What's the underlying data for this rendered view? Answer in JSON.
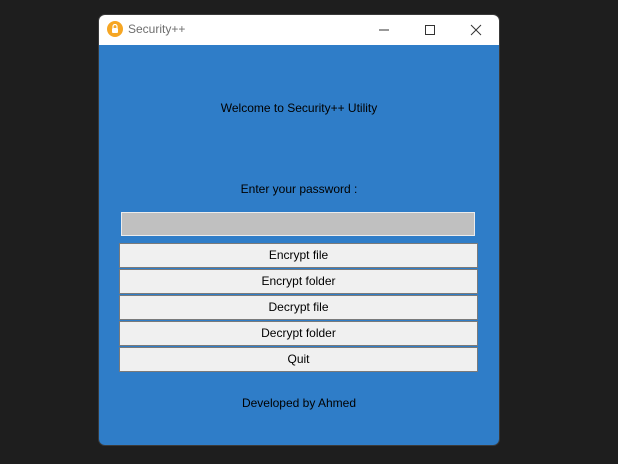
{
  "window": {
    "title": "Security++",
    "icon": "lock-icon",
    "controls": [
      "minimize-icon",
      "maximize-icon",
      "close-icon"
    ]
  },
  "content": {
    "welcome": "Welcome to Security++ Utility",
    "password_prompt": "Enter your password :",
    "password_value": "",
    "buttons": {
      "encrypt_file": "Encrypt file",
      "encrypt_folder": "Encrypt folder",
      "decrypt_file": "Decrypt file",
      "decrypt_folder": "Decrypt folder",
      "quit": "Quit"
    },
    "footer": "Developed by Ahmed"
  },
  "colors": {
    "background": "#2f7dc8",
    "field": "#c0c0c0",
    "button": "#f0f0f0",
    "icon": "#f6a623"
  }
}
